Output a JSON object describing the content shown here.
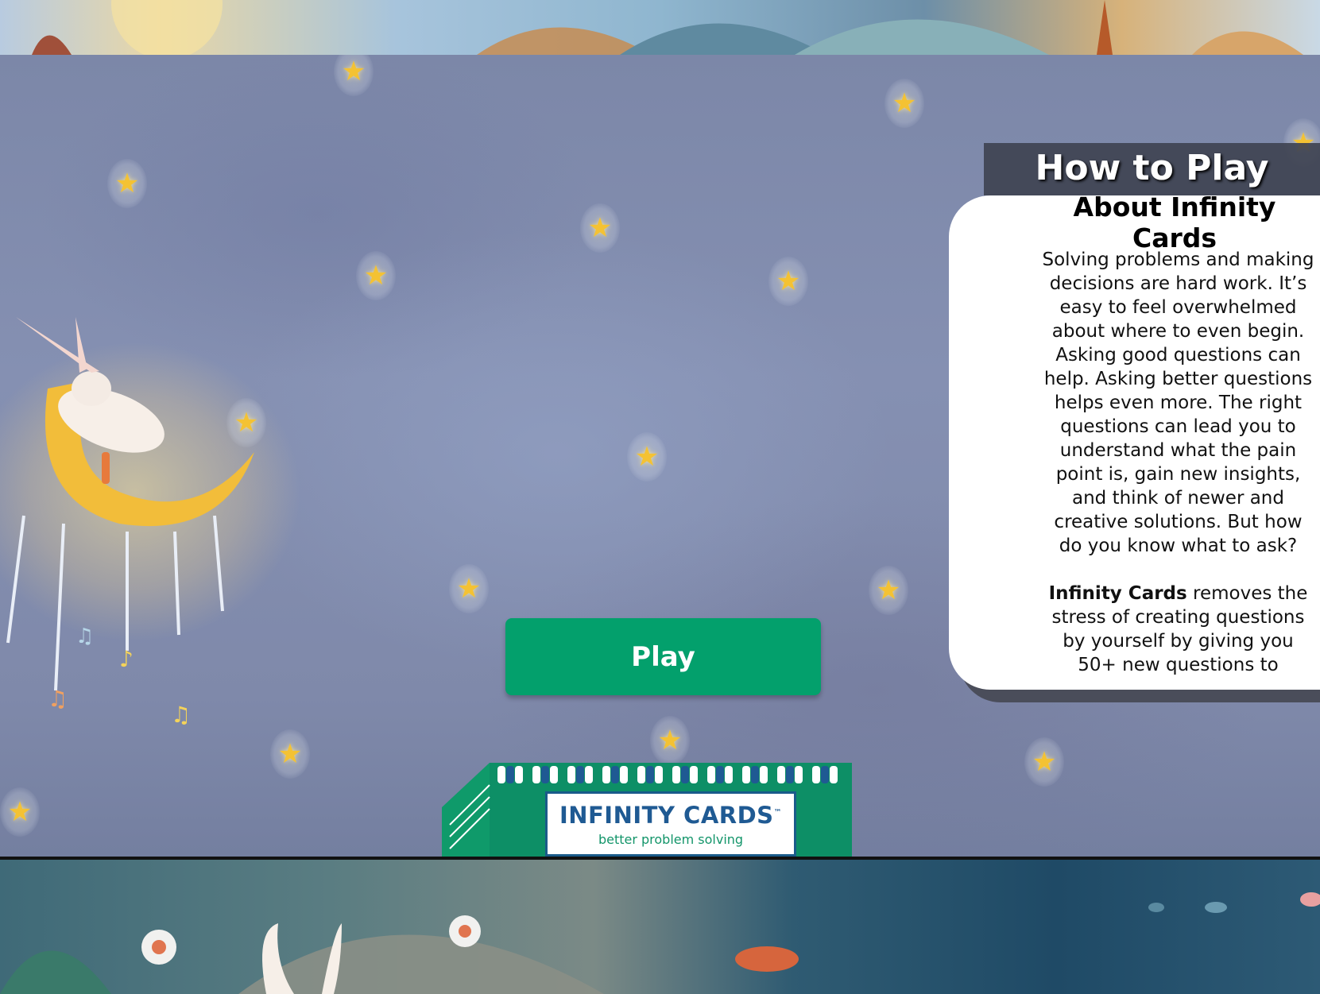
{
  "play_button": {
    "label": "Play"
  },
  "deck": {
    "title": "INFINITY CARDS",
    "trademark": "™",
    "subtitle": "better problem solving"
  },
  "how_to_play": {
    "header": "How to Play",
    "title": "About Infinity Cards",
    "paragraph_1": "Solving problems and making decisions are hard work. It’s easy to feel overwhelmed about where to even begin. Asking good questions can help. Asking better questions helps even more. The right questions can lead you to understand what the pain point is, gain new insights, and think of newer and creative solutions. But how do you know what to ask?",
    "paragraph_2_bold": "Infinity Cards",
    "paragraph_2_rest": " removes the stress of creating questions by yourself by giving you 50+ new questions to"
  },
  "colors": {
    "play_button": "#03a06c",
    "panel_header": "#3f4351",
    "deck_title": "#1f5a93",
    "deck_subtitle": "#13956a",
    "star": "#f4c233"
  },
  "icons": [
    "star-icon",
    "bunny-on-moon-illustration",
    "card-deck-illustration"
  ]
}
